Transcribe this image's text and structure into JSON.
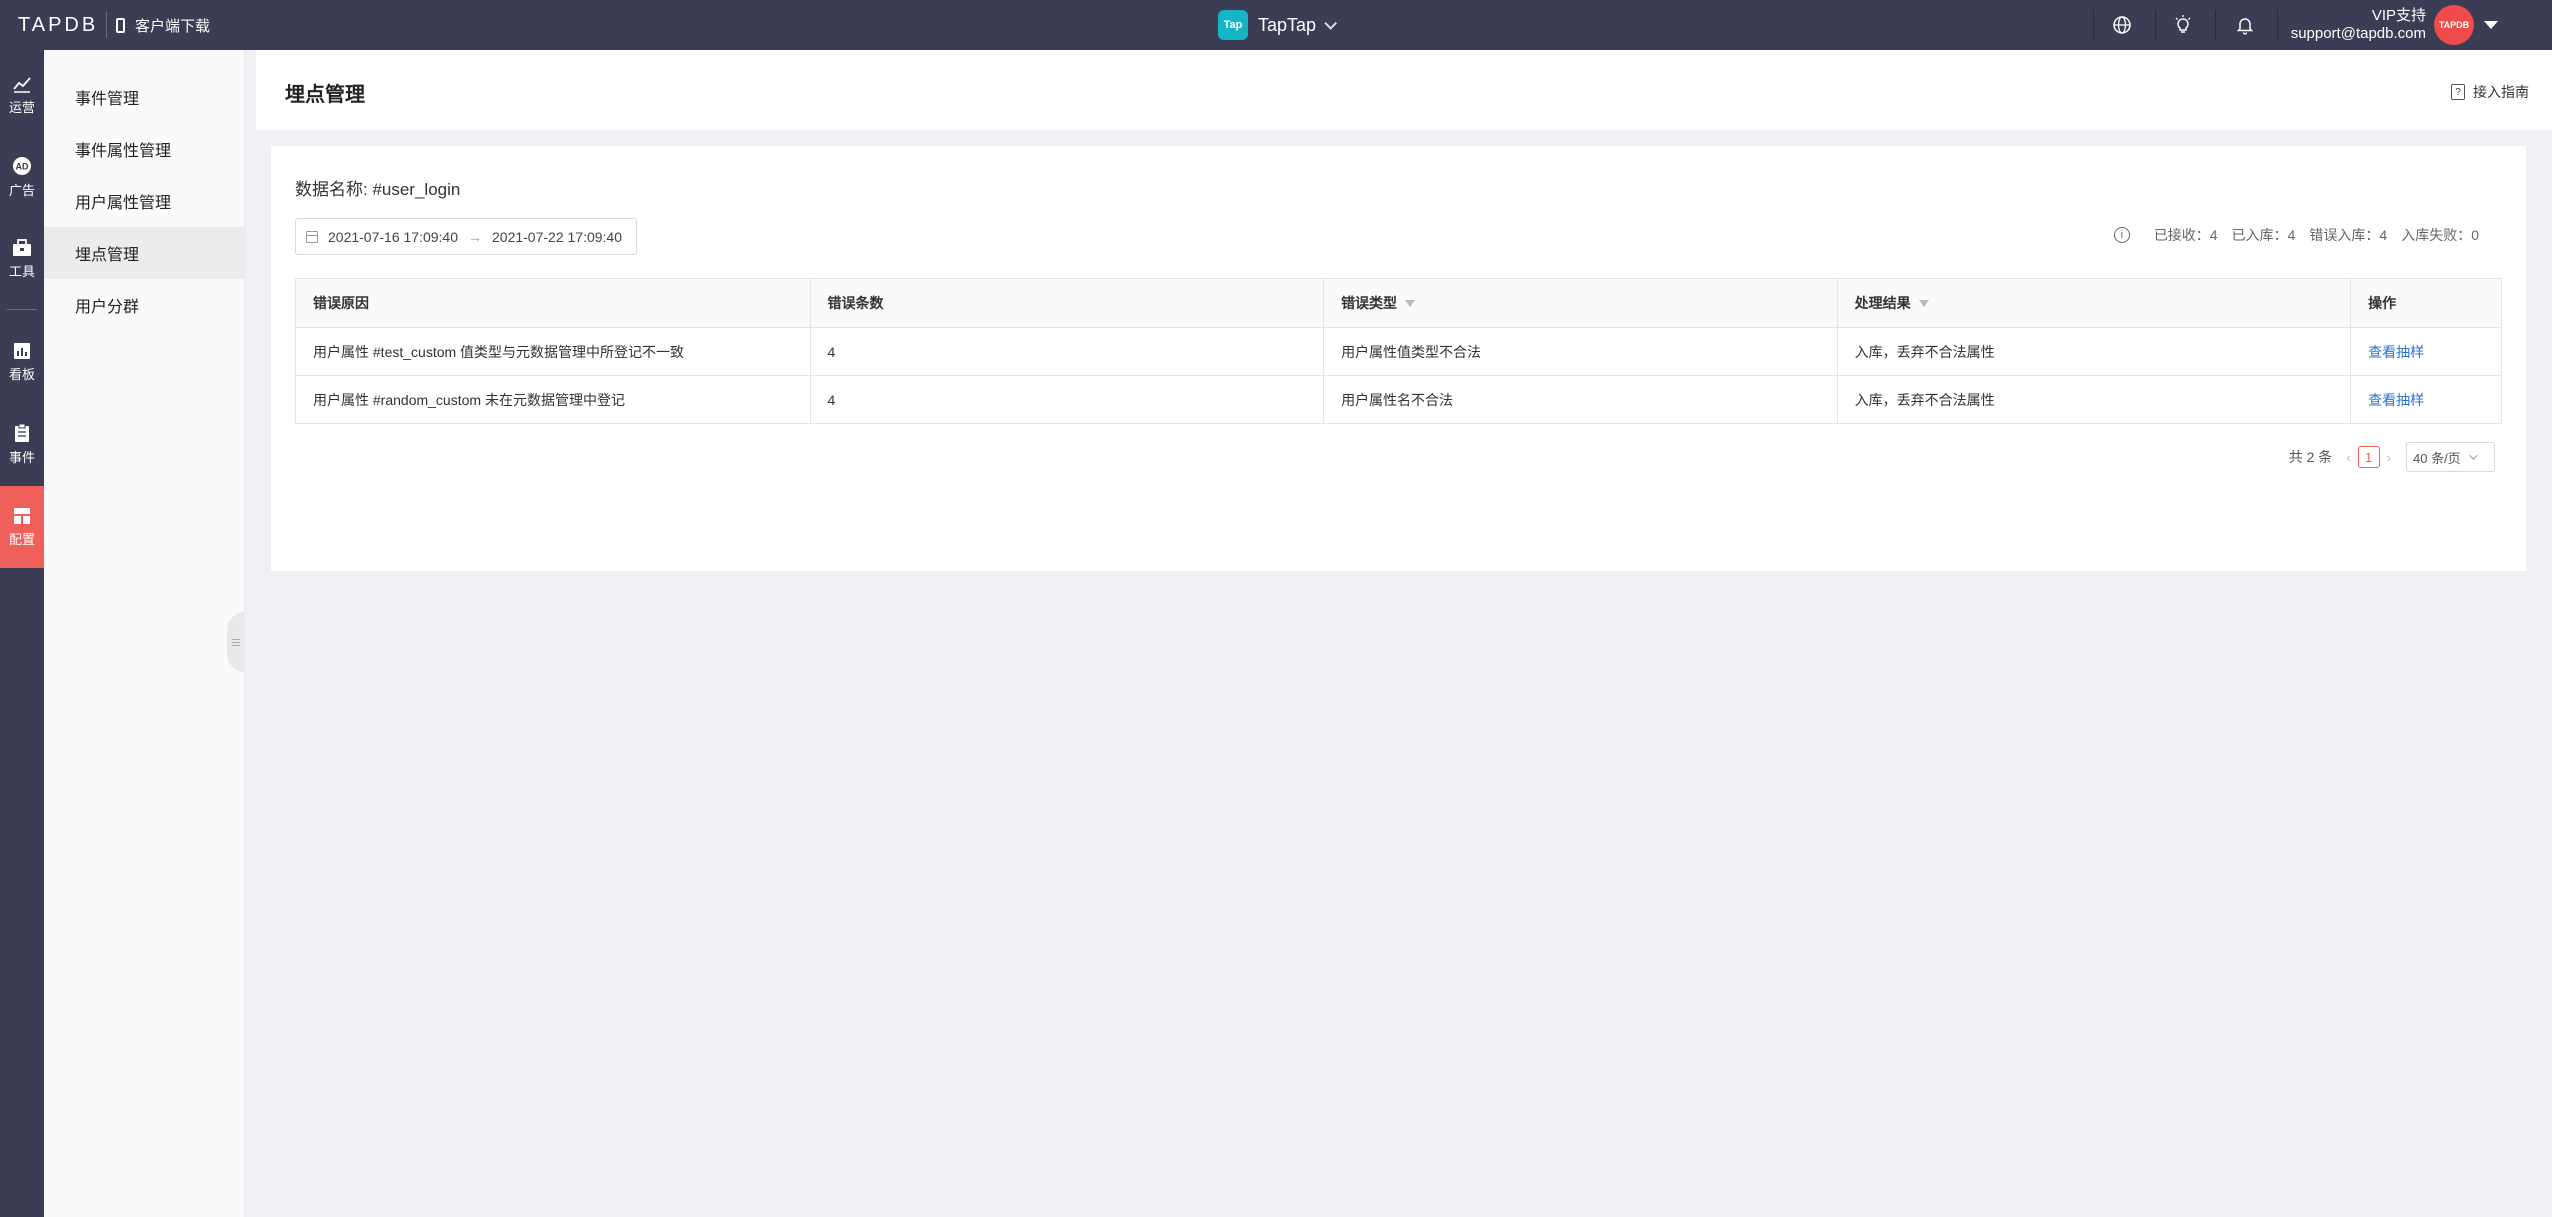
{
  "topbar": {
    "logo": "TAPDB",
    "download_label": "客户端下载",
    "app_name": "TapTap",
    "app_logo_text": "Tap",
    "vip_label": "VIP支持",
    "email": "support@tapdb.com",
    "avatar_text": "TAPDB"
  },
  "rail": [
    {
      "label": "运营",
      "icon": "chart-up-icon"
    },
    {
      "label": "广告",
      "icon": "ad-icon"
    },
    {
      "label": "工具",
      "icon": "toolbox-icon"
    },
    {
      "label": "看板",
      "icon": "dashboard-icon"
    },
    {
      "label": "事件",
      "icon": "clipboard-icon"
    },
    {
      "label": "配置",
      "icon": "config-icon",
      "active": true
    }
  ],
  "submenu": [
    {
      "label": "事件管理"
    },
    {
      "label": "事件属性管理"
    },
    {
      "label": "用户属性管理"
    },
    {
      "label": "埋点管理",
      "active": true
    },
    {
      "label": "用户分群"
    }
  ],
  "page": {
    "title": "埋点管理",
    "guide_label": "接入指南",
    "data_name": "数据名称: #user_login",
    "date_start": "2021-07-16 17:09:40",
    "date_end": "2021-07-22 17:09:40",
    "stats": {
      "received": "已接收：4",
      "stored": "已入库：4",
      "error_stored": "错误入库：4",
      "failed": "入库失败：0"
    }
  },
  "table": {
    "headers": [
      "错误原因",
      "错误条数",
      "错误类型",
      "处理结果",
      "操作"
    ],
    "rows": [
      [
        "用户属性 #test_custom 值类型与元数据管理中所登记不一致",
        "4",
        "用户属性值类型不合法",
        "入库，丢弃不合法属性",
        "查看抽样"
      ],
      [
        "用户属性 #random_custom 未在元数据管理中登记",
        "4",
        "用户属性名不合法",
        "入库，丢弃不合法属性",
        "查看抽样"
      ]
    ]
  },
  "pager": {
    "total": "共 2 条",
    "current": "1",
    "page_size": "40 条/页"
  },
  "colors": {
    "topbar": "#3b3d54",
    "accent": "#f0605b",
    "link": "#2f6fd6",
    "app_logo": "#16b5c6"
  }
}
